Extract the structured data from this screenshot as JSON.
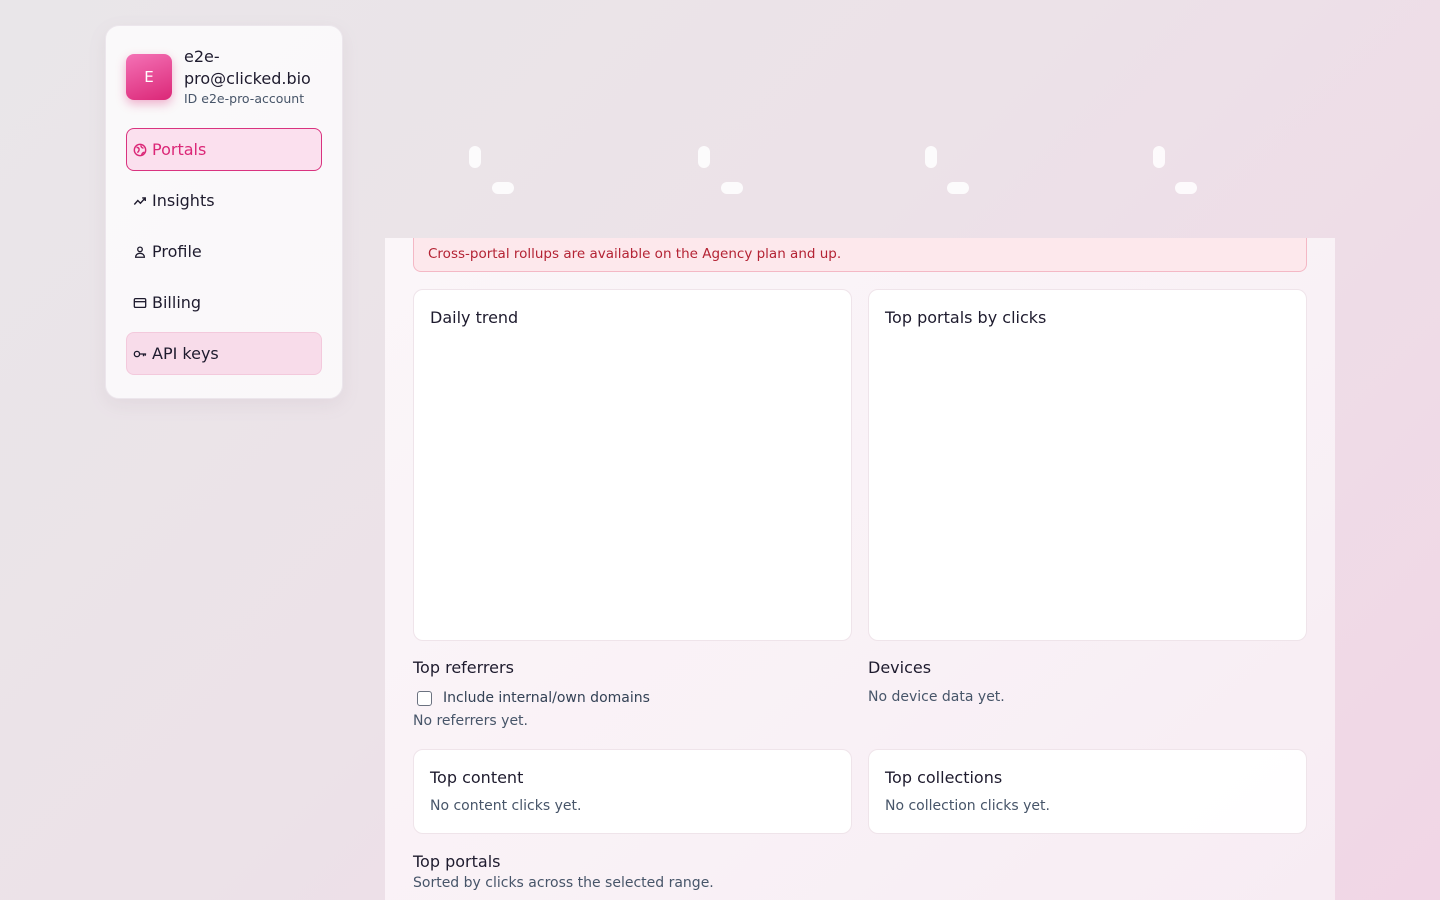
{
  "account": {
    "avatar_letter": "E",
    "email": "e2e-pro@clicked.bio",
    "id_label": "ID e2e-pro-account"
  },
  "nav": [
    {
      "label": "Portals",
      "icon": "globe-icon",
      "state": "active"
    },
    {
      "label": "Insights",
      "icon": "trend-icon",
      "state": ""
    },
    {
      "label": "Profile",
      "icon": "user-icon",
      "state": ""
    },
    {
      "label": "Billing",
      "icon": "credit-card-icon",
      "state": ""
    },
    {
      "label": "API keys",
      "icon": "key-icon",
      "state": "hover"
    }
  ],
  "alert": {
    "text": "Cross-portal rollups are available on the Agency plan and up."
  },
  "cards": {
    "daily_trend": {
      "title": "Daily trend"
    },
    "top_portals_clicks": {
      "title": "Top portals by clicks"
    },
    "top_content": {
      "title": "Top content",
      "empty": "No content clicks yet."
    },
    "top_collections": {
      "title": "Top collections",
      "empty": "No collection clicks yet."
    }
  },
  "referrers": {
    "title": "Top referrers",
    "checkbox_label": "Include internal/own domains",
    "empty": "No referrers yet."
  },
  "devices": {
    "title": "Devices",
    "empty": "No device data yet."
  },
  "top_portals": {
    "title": "Top portals",
    "subtitle": "Sorted by clicks across the selected range."
  },
  "colors": {
    "accent": "#db2777",
    "alert_text": "#b42334",
    "alert_bg": "#fde8ec"
  }
}
